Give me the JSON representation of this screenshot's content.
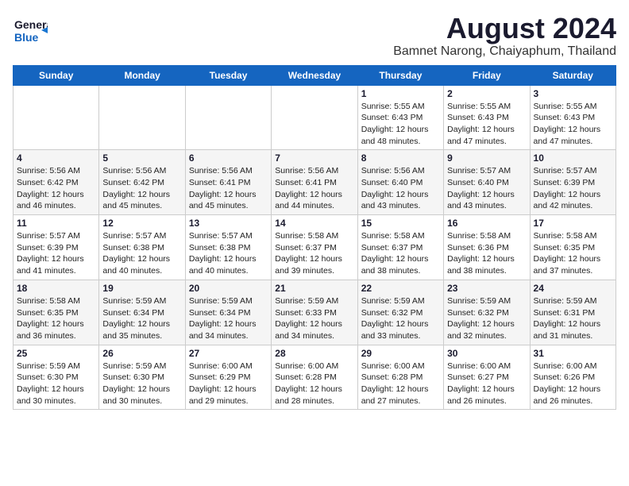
{
  "header": {
    "logo_line1": "General",
    "logo_line2": "Blue",
    "title": "August 2024",
    "subtitle": "Bamnet Narong, Chaiyaphum, Thailand"
  },
  "calendar": {
    "weekdays": [
      "Sunday",
      "Monday",
      "Tuesday",
      "Wednesday",
      "Thursday",
      "Friday",
      "Saturday"
    ],
    "weeks": [
      [
        {
          "day": "",
          "info": ""
        },
        {
          "day": "",
          "info": ""
        },
        {
          "day": "",
          "info": ""
        },
        {
          "day": "",
          "info": ""
        },
        {
          "day": "1",
          "info": "Sunrise: 5:55 AM\nSunset: 6:43 PM\nDaylight: 12 hours\nand 48 minutes."
        },
        {
          "day": "2",
          "info": "Sunrise: 5:55 AM\nSunset: 6:43 PM\nDaylight: 12 hours\nand 47 minutes."
        },
        {
          "day": "3",
          "info": "Sunrise: 5:55 AM\nSunset: 6:43 PM\nDaylight: 12 hours\nand 47 minutes."
        }
      ],
      [
        {
          "day": "4",
          "info": "Sunrise: 5:56 AM\nSunset: 6:42 PM\nDaylight: 12 hours\nand 46 minutes."
        },
        {
          "day": "5",
          "info": "Sunrise: 5:56 AM\nSunset: 6:42 PM\nDaylight: 12 hours\nand 45 minutes."
        },
        {
          "day": "6",
          "info": "Sunrise: 5:56 AM\nSunset: 6:41 PM\nDaylight: 12 hours\nand 45 minutes."
        },
        {
          "day": "7",
          "info": "Sunrise: 5:56 AM\nSunset: 6:41 PM\nDaylight: 12 hours\nand 44 minutes."
        },
        {
          "day": "8",
          "info": "Sunrise: 5:56 AM\nSunset: 6:40 PM\nDaylight: 12 hours\nand 43 minutes."
        },
        {
          "day": "9",
          "info": "Sunrise: 5:57 AM\nSunset: 6:40 PM\nDaylight: 12 hours\nand 43 minutes."
        },
        {
          "day": "10",
          "info": "Sunrise: 5:57 AM\nSunset: 6:39 PM\nDaylight: 12 hours\nand 42 minutes."
        }
      ],
      [
        {
          "day": "11",
          "info": "Sunrise: 5:57 AM\nSunset: 6:39 PM\nDaylight: 12 hours\nand 41 minutes."
        },
        {
          "day": "12",
          "info": "Sunrise: 5:57 AM\nSunset: 6:38 PM\nDaylight: 12 hours\nand 40 minutes."
        },
        {
          "day": "13",
          "info": "Sunrise: 5:57 AM\nSunset: 6:38 PM\nDaylight: 12 hours\nand 40 minutes."
        },
        {
          "day": "14",
          "info": "Sunrise: 5:58 AM\nSunset: 6:37 PM\nDaylight: 12 hours\nand 39 minutes."
        },
        {
          "day": "15",
          "info": "Sunrise: 5:58 AM\nSunset: 6:37 PM\nDaylight: 12 hours\nand 38 minutes."
        },
        {
          "day": "16",
          "info": "Sunrise: 5:58 AM\nSunset: 6:36 PM\nDaylight: 12 hours\nand 38 minutes."
        },
        {
          "day": "17",
          "info": "Sunrise: 5:58 AM\nSunset: 6:35 PM\nDaylight: 12 hours\nand 37 minutes."
        }
      ],
      [
        {
          "day": "18",
          "info": "Sunrise: 5:58 AM\nSunset: 6:35 PM\nDaylight: 12 hours\nand 36 minutes."
        },
        {
          "day": "19",
          "info": "Sunrise: 5:59 AM\nSunset: 6:34 PM\nDaylight: 12 hours\nand 35 minutes."
        },
        {
          "day": "20",
          "info": "Sunrise: 5:59 AM\nSunset: 6:34 PM\nDaylight: 12 hours\nand 34 minutes."
        },
        {
          "day": "21",
          "info": "Sunrise: 5:59 AM\nSunset: 6:33 PM\nDaylight: 12 hours\nand 34 minutes."
        },
        {
          "day": "22",
          "info": "Sunrise: 5:59 AM\nSunset: 6:32 PM\nDaylight: 12 hours\nand 33 minutes."
        },
        {
          "day": "23",
          "info": "Sunrise: 5:59 AM\nSunset: 6:32 PM\nDaylight: 12 hours\nand 32 minutes."
        },
        {
          "day": "24",
          "info": "Sunrise: 5:59 AM\nSunset: 6:31 PM\nDaylight: 12 hours\nand 31 minutes."
        }
      ],
      [
        {
          "day": "25",
          "info": "Sunrise: 5:59 AM\nSunset: 6:30 PM\nDaylight: 12 hours\nand 30 minutes."
        },
        {
          "day": "26",
          "info": "Sunrise: 5:59 AM\nSunset: 6:30 PM\nDaylight: 12 hours\nand 30 minutes."
        },
        {
          "day": "27",
          "info": "Sunrise: 6:00 AM\nSunset: 6:29 PM\nDaylight: 12 hours\nand 29 minutes."
        },
        {
          "day": "28",
          "info": "Sunrise: 6:00 AM\nSunset: 6:28 PM\nDaylight: 12 hours\nand 28 minutes."
        },
        {
          "day": "29",
          "info": "Sunrise: 6:00 AM\nSunset: 6:28 PM\nDaylight: 12 hours\nand 27 minutes."
        },
        {
          "day": "30",
          "info": "Sunrise: 6:00 AM\nSunset: 6:27 PM\nDaylight: 12 hours\nand 26 minutes."
        },
        {
          "day": "31",
          "info": "Sunrise: 6:00 AM\nSunset: 6:26 PM\nDaylight: 12 hours\nand 26 minutes."
        }
      ]
    ]
  }
}
